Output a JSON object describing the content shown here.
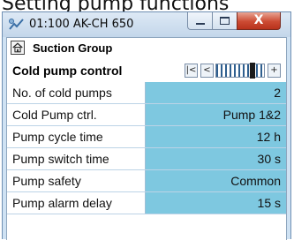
{
  "page_heading": "Setting pump functions",
  "window": {
    "title": "01:100 AK-CH 650",
    "controls": {
      "close_glyph": "X"
    }
  },
  "group": {
    "label": "Suction Group"
  },
  "control_bar": {
    "label": "Cold pump control",
    "nav": {
      "first_glyph": "|<",
      "prev_glyph": "<",
      "next_glyph": "+"
    },
    "slider_position": 0.8
  },
  "parameters": [
    {
      "label": "No. of cold pumps",
      "value": "2"
    },
    {
      "label": "Cold Pump ctrl.",
      "value": "Pump 1&2"
    },
    {
      "label": "Pump cycle time",
      "value": "12 h"
    },
    {
      "label": "Pump switch time",
      "value": "30 s"
    },
    {
      "label": "Pump safety",
      "value": "Common"
    },
    {
      "label": "Pump alarm delay",
      "value": "15 s"
    }
  ],
  "colors": {
    "value_cell": "#7ec8e0",
    "window_frame": "#cfe2f3",
    "close_button": "#cc4b33"
  }
}
